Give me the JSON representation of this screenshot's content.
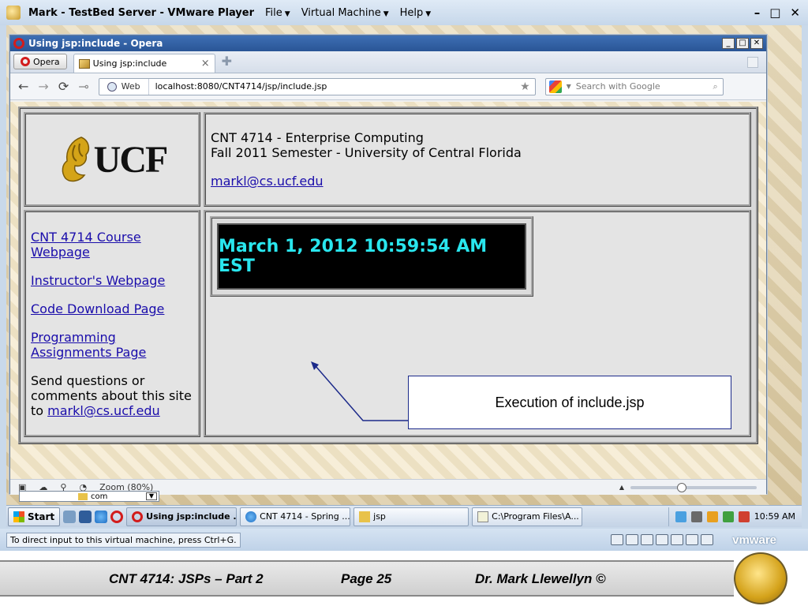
{
  "vm": {
    "title": "Mark - TestBed Server - VMware Player",
    "menu": [
      "File",
      "Virtual Machine",
      "Help"
    ],
    "status_text": "To direct input to this virtual machine, press Ctrl+G.",
    "brand": "vmware"
  },
  "opera": {
    "window_title": "Using jsp:include - Opera",
    "menu_button": "Opera",
    "tab_label": "Using jsp:include",
    "address_scope": "Web",
    "url": "localhost:8080/CNT4714/jsp/include.jsp",
    "search_placeholder": "Search with Google",
    "zoom": "Zoom (80%)",
    "zoom_level": 0.8
  },
  "page": {
    "logo_text": "UCF",
    "header_line1": "CNT 4714 - Enterprise Computing",
    "header_line2": "Fall 2011 Semester - University of Central Florida",
    "header_email": "markl@cs.ucf.edu",
    "nav_links": [
      "CNT 4714 Course Webpage",
      "Instructor's Webpage",
      "Code Download Page",
      "Programming Assignments Page"
    ],
    "nav_note": "Send questions or comments about this site to",
    "nav_email": "markl@cs.ucf.edu",
    "clock": "March 1, 2012 10:59:54 AM EST",
    "clock_color": "#29e6ee"
  },
  "annotation": {
    "callout": "Execution of include.jsp"
  },
  "behind_window": {
    "field_text": "com"
  },
  "taskbar": {
    "start": "Start",
    "buttons": [
      "Using jsp:include ...",
      "CNT 4714 - Spring ...",
      "jsp",
      "C:\\Program Files\\A..."
    ],
    "clock": "10:59 AM"
  },
  "footer": {
    "course": "CNT 4714: JSPs – Part 2",
    "page": "Page 25",
    "author": "Dr. Mark Llewellyn ©"
  }
}
